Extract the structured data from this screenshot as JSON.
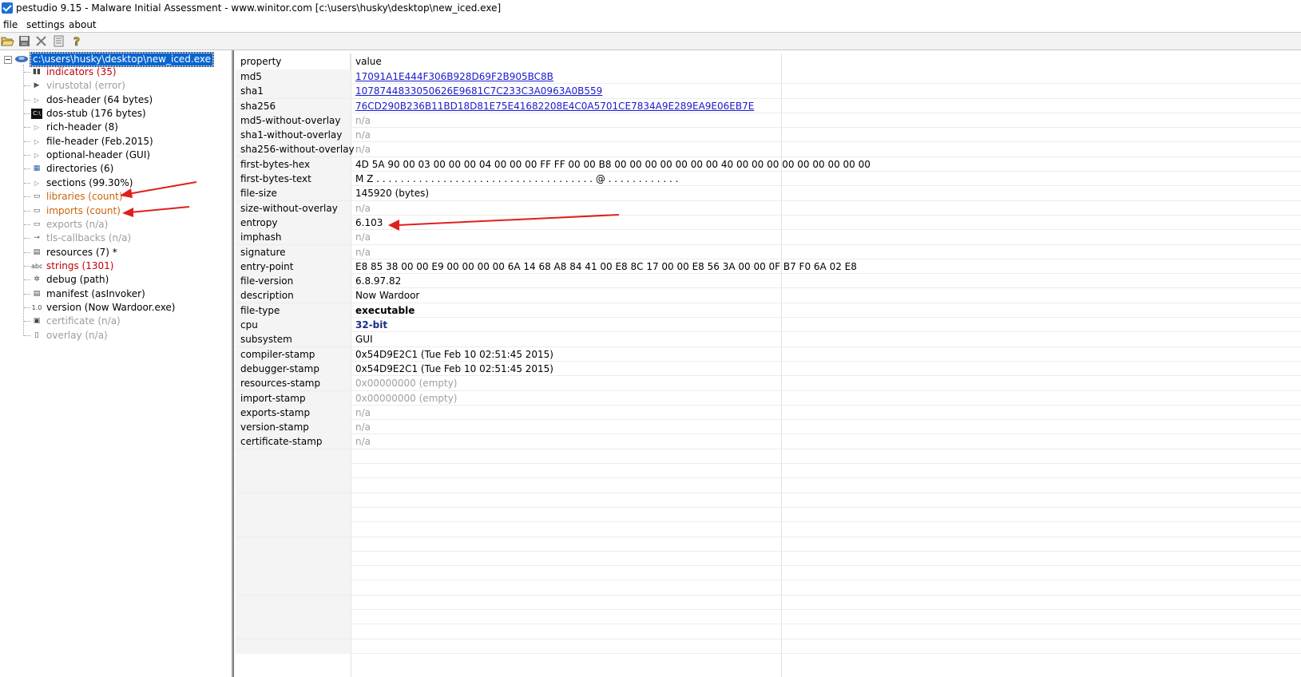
{
  "window": {
    "title": "pestudio 9.15 - Malware Initial Assessment - www.winitor.com [c:\\users\\husky\\desktop\\new_iced.exe]"
  },
  "menu": {
    "file": "file",
    "settings": "settings",
    "about": "about"
  },
  "toolbar": {
    "icons": [
      "open-icon",
      "save-icon",
      "close-icon",
      "list-icon",
      "help-icon"
    ]
  },
  "tree": {
    "root": "c:\\users\\husky\\desktop\\new_iced.exe",
    "items": [
      {
        "label": "indicators (35)",
        "color": "#c0000a",
        "icon": "indicators-icon"
      },
      {
        "label": "virustotal (error)",
        "color": "#9c9c9c",
        "icon": "virustotal-icon"
      },
      {
        "label": "dos-header (64 bytes)",
        "color": "#000000",
        "icon": "expand-icon"
      },
      {
        "label": "dos-stub (176 bytes)",
        "color": "#000000",
        "icon": "console-icon"
      },
      {
        "label": "rich-header (8)",
        "color": "#000000",
        "icon": "expand-icon"
      },
      {
        "label": "file-header (Feb.2015)",
        "color": "#000000",
        "icon": "expand-icon"
      },
      {
        "label": "optional-header (GUI)",
        "color": "#000000",
        "icon": "expand-icon"
      },
      {
        "label": "directories (6)",
        "color": "#000000",
        "icon": "directories-icon"
      },
      {
        "label": "sections (99.30%)",
        "color": "#000000",
        "icon": "expand-icon"
      },
      {
        "label": "libraries (count)",
        "color": "#c8640a",
        "icon": "libraries-icon"
      },
      {
        "label": "imports (count)",
        "color": "#c8640a",
        "icon": "imports-icon"
      },
      {
        "label": "exports (n/a)",
        "color": "#9c9c9c",
        "icon": "exports-icon"
      },
      {
        "label": "tls-callbacks (n/a)",
        "color": "#9c9c9c",
        "icon": "tls-icon"
      },
      {
        "label": "resources (7) *",
        "color": "#000000",
        "icon": "resources-icon"
      },
      {
        "label": "strings (1301)",
        "color": "#c0000a",
        "icon": "strings-icon"
      },
      {
        "label": "debug (path)",
        "color": "#000000",
        "icon": "debug-icon"
      },
      {
        "label": "manifest (asInvoker)",
        "color": "#000000",
        "icon": "manifest-icon"
      },
      {
        "label": "version (Now Wardoor.exe)",
        "color": "#000000",
        "icon": "version-icon"
      },
      {
        "label": "certificate (n/a)",
        "color": "#9c9c9c",
        "icon": "certificate-icon"
      },
      {
        "label": "overlay (n/a)",
        "color": "#9c9c9c",
        "icon": "overlay-icon"
      }
    ]
  },
  "grid": {
    "header_property": "property",
    "header_value": "value",
    "rows": [
      {
        "property": "md5",
        "value": "17091A1E444F306B928D69F2B905BC8B",
        "style": "link"
      },
      {
        "property": "sha1",
        "value": "1078744833050626E9681C7C233C3A0963A0B559",
        "style": "link"
      },
      {
        "property": "sha256",
        "value": "76CD290B236B11BD18D81E75E41682208E4C0A5701CE7834A9E289EA9E06EB7E",
        "style": "link"
      },
      {
        "property": "md5-without-overlay",
        "value": "n/a",
        "style": "gray"
      },
      {
        "property": "sha1-without-overlay",
        "value": "n/a",
        "style": "gray"
      },
      {
        "property": "sha256-without-overlay",
        "value": "n/a",
        "style": "gray"
      },
      {
        "property": "first-bytes-hex",
        "value": "4D 5A 90 00 03 00 00 00 04 00 00 00 FF FF 00 00 B8 00 00 00 00 00 00 00 40 00 00 00 00 00 00 00 00 00",
        "style": "normal"
      },
      {
        "property": "first-bytes-text",
        "value": "M Z . . . . . . . . . . . . . . . . . . . . . . . . . . . . . . . . . . . . @ . . . . . . . . . . . .",
        "style": "normal"
      },
      {
        "property": "file-size",
        "value": "145920 (bytes)",
        "style": "normal"
      },
      {
        "property": "size-without-overlay",
        "value": "n/a",
        "style": "gray"
      },
      {
        "property": "entropy",
        "value": "6.103",
        "style": "normal"
      },
      {
        "property": "imphash",
        "value": "n/a",
        "style": "gray"
      },
      {
        "property": "signature",
        "value": "n/a",
        "style": "gray"
      },
      {
        "property": "entry-point",
        "value": "E8 85 38 00 00 E9 00 00 00 00 6A 14 68 A8 84 41 00 E8 8C 17 00 00 E8 56 3A 00 00 0F B7 F0 6A 02 E8",
        "style": "normal"
      },
      {
        "property": "file-version",
        "value": "6.8.97.82",
        "style": "normal"
      },
      {
        "property": "description",
        "value": "Now Wardoor",
        "style": "normal"
      },
      {
        "property": "file-type",
        "value": "executable",
        "style": "bold"
      },
      {
        "property": "cpu",
        "value": "32-bit",
        "style": "bold-blue"
      },
      {
        "property": "subsystem",
        "value": "GUI",
        "style": "normal"
      },
      {
        "property": "compiler-stamp",
        "value": "0x54D9E2C1 (Tue Feb 10 02:51:45 2015)",
        "style": "normal"
      },
      {
        "property": "debugger-stamp",
        "value": "0x54D9E2C1 (Tue Feb 10 02:51:45 2015)",
        "style": "normal"
      },
      {
        "property": "resources-stamp",
        "value": "0x00000000 (empty)",
        "style": "gray"
      },
      {
        "property": "import-stamp",
        "value": "0x00000000 (empty)",
        "style": "gray"
      },
      {
        "property": "exports-stamp",
        "value": "n/a",
        "style": "gray"
      },
      {
        "property": "version-stamp",
        "value": "n/a",
        "style": "gray"
      },
      {
        "property": "certificate-stamp",
        "value": "n/a",
        "style": "gray"
      }
    ]
  },
  "annotations": {
    "arrow_color": "#e0201c"
  }
}
